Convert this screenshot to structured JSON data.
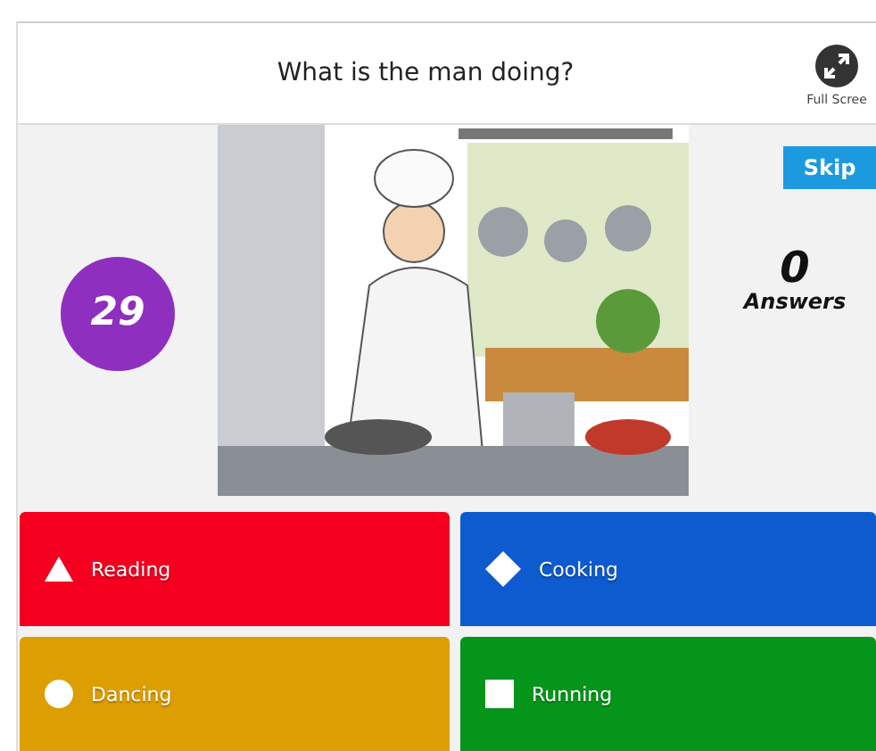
{
  "header": {
    "question": "What is the man doing?",
    "fullscreen_label": "Full Scree"
  },
  "timer": "29",
  "skip_button": "Skip",
  "answers_count": {
    "value": "0",
    "label": "Answers"
  },
  "answers": [
    {
      "label": "Reading",
      "kind": "triangle",
      "color": "#f5001f"
    },
    {
      "label": "Cooking",
      "kind": "diamond",
      "color": "#0e5bcf"
    },
    {
      "label": "Dancing",
      "kind": "circle",
      "color": "#dc9e00"
    },
    {
      "label": "Running",
      "kind": "square",
      "color": "#06951b"
    }
  ]
}
